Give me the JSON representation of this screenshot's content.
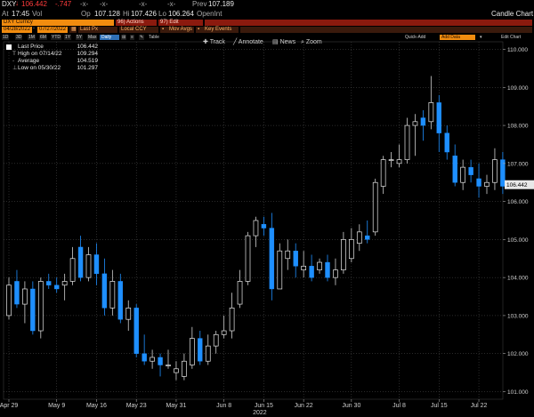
{
  "header": {
    "ticker": "DXY",
    "last_price": "106.442",
    "net_change": "-.747",
    "prev_label": "Prev",
    "prev_value": "107.189",
    "time_label": "At",
    "time": "17:45",
    "vol_label": "Vol",
    "op_label": "Op",
    "op_value": "107.128",
    "hi_label": "Hi",
    "hi_value": "107.426",
    "lo_label": "Lo",
    "lo_value": "106.264",
    "openint_label": "OpenInt",
    "chart_title": "Candle Chart"
  },
  "toolbar": {
    "security": "DXY Curncy",
    "actions": "96) Actions",
    "edit": "97) Edit",
    "start_date": "04/28/2022",
    "end_date": "07/27/2022",
    "last_px": "Last Px",
    "local_ccy": "Local CCY",
    "mov_avgs": "Mov Avgs",
    "key_events": "Key Events",
    "periods": [
      "1D",
      "3D",
      "1M",
      "6M",
      "YTD",
      "1Y",
      "5Y",
      "Max"
    ],
    "frequency": "Daily",
    "table": "Table",
    "quick_add": "Quick-Add",
    "add_data": "Add Data",
    "edit_chart": "Edit Chart"
  },
  "chart_tools": {
    "track": "Track",
    "annotate": "Annotate",
    "news": "News",
    "zoom": "Zoom"
  },
  "legend": [
    {
      "name": "Last Price",
      "value": "106.442"
    },
    {
      "name": "High on 07/14/22",
      "value": "109.294"
    },
    {
      "name": "Average",
      "value": "104.519"
    },
    {
      "name": "Low on 05/30/22",
      "value": "101.297"
    }
  ],
  "colors": {
    "up": "#ffffff",
    "down": "#1e8fff",
    "accent": "#f28c0f",
    "negative": "#ff3b3b"
  },
  "chart_data": {
    "type": "candlestick",
    "year_label": "2022",
    "ylim": [
      100.8,
      110.2
    ],
    "yticks": [
      101.0,
      102.0,
      103.0,
      104.0,
      105.0,
      106.0,
      107.0,
      108.0,
      109.0,
      110.0
    ],
    "last_price_marker": 106.442,
    "xtick_labels": [
      {
        "label": "Apr 29",
        "index": 0
      },
      {
        "label": "May 9",
        "index": 6
      },
      {
        "label": "May 16",
        "index": 11
      },
      {
        "label": "May 23",
        "index": 16
      },
      {
        "label": "May 31",
        "index": 21
      },
      {
        "label": "Jun 8",
        "index": 27
      },
      {
        "label": "Jun 15",
        "index": 32
      },
      {
        "label": "Jun 22",
        "index": 37
      },
      {
        "label": "Jun 30",
        "index": 43
      },
      {
        "label": "Jul 8",
        "index": 49
      },
      {
        "label": "Jul 15",
        "index": 54
      },
      {
        "label": "Jul 22",
        "index": 59
      }
    ],
    "candles": [
      {
        "o": 103.0,
        "h": 104.0,
        "l": 102.9,
        "c": 103.8
      },
      {
        "o": 103.9,
        "h": 104.2,
        "l": 103.2,
        "c": 103.3
      },
      {
        "o": 103.3,
        "h": 103.9,
        "l": 102.8,
        "c": 103.7
      },
      {
        "o": 103.7,
        "h": 103.9,
        "l": 102.5,
        "c": 102.6
      },
      {
        "o": 102.6,
        "h": 104.0,
        "l": 102.4,
        "c": 103.9
      },
      {
        "o": 103.9,
        "h": 104.1,
        "l": 103.7,
        "c": 103.8
      },
      {
        "o": 103.8,
        "h": 104.0,
        "l": 103.6,
        "c": 103.7
      },
      {
        "o": 103.8,
        "h": 104.1,
        "l": 103.4,
        "c": 103.9
      },
      {
        "o": 103.9,
        "h": 104.8,
        "l": 103.8,
        "c": 104.5
      },
      {
        "o": 104.8,
        "h": 105.1,
        "l": 103.9,
        "c": 104.0
      },
      {
        "o": 104.0,
        "h": 104.8,
        "l": 103.9,
        "c": 104.6
      },
      {
        "o": 104.6,
        "h": 104.9,
        "l": 103.8,
        "c": 104.1
      },
      {
        "o": 104.1,
        "h": 104.5,
        "l": 103.0,
        "c": 103.2
      },
      {
        "o": 103.2,
        "h": 104.2,
        "l": 103.0,
        "c": 103.9
      },
      {
        "o": 103.9,
        "h": 104.1,
        "l": 102.8,
        "c": 102.9
      },
      {
        "o": 102.9,
        "h": 103.4,
        "l": 102.6,
        "c": 103.2
      },
      {
        "o": 103.2,
        "h": 103.3,
        "l": 101.9,
        "c": 102.0
      },
      {
        "o": 102.0,
        "h": 102.5,
        "l": 101.7,
        "c": 101.8
      },
      {
        "o": 101.8,
        "h": 102.1,
        "l": 101.6,
        "c": 101.9
      },
      {
        "o": 101.9,
        "h": 102.0,
        "l": 101.4,
        "c": 101.7
      },
      {
        "o": 101.7,
        "h": 102.1,
        "l": 101.6,
        "c": 101.7
      },
      {
        "o": 101.5,
        "h": 101.8,
        "l": 101.3,
        "c": 101.6
      },
      {
        "o": 101.4,
        "h": 102.0,
        "l": 101.3,
        "c": 101.8
      },
      {
        "o": 101.7,
        "h": 102.7,
        "l": 101.6,
        "c": 102.4
      },
      {
        "o": 102.4,
        "h": 102.6,
        "l": 101.7,
        "c": 101.8
      },
      {
        "o": 101.8,
        "h": 102.5,
        "l": 101.7,
        "c": 102.2
      },
      {
        "o": 102.2,
        "h": 102.6,
        "l": 102.0,
        "c": 102.5
      },
      {
        "o": 102.5,
        "h": 103.0,
        "l": 102.4,
        "c": 102.6
      },
      {
        "o": 102.6,
        "h": 103.6,
        "l": 102.4,
        "c": 103.2
      },
      {
        "o": 103.3,
        "h": 104.2,
        "l": 103.2,
        "c": 103.9
      },
      {
        "o": 103.9,
        "h": 105.2,
        "l": 103.8,
        "c": 105.1
      },
      {
        "o": 105.1,
        "h": 105.6,
        "l": 104.8,
        "c": 105.5
      },
      {
        "o": 105.4,
        "h": 105.6,
        "l": 105.1,
        "c": 105.3
      },
      {
        "o": 105.3,
        "h": 105.7,
        "l": 103.4,
        "c": 103.7
      },
      {
        "o": 103.7,
        "h": 104.9,
        "l": 103.7,
        "c": 104.7
      },
      {
        "o": 104.5,
        "h": 105.0,
        "l": 104.2,
        "c": 104.7
      },
      {
        "o": 104.7,
        "h": 104.9,
        "l": 104.0,
        "c": 104.3
      },
      {
        "o": 104.2,
        "h": 104.7,
        "l": 104.0,
        "c": 104.3
      },
      {
        "o": 104.3,
        "h": 104.6,
        "l": 103.9,
        "c": 104.0
      },
      {
        "o": 104.2,
        "h": 104.5,
        "l": 104.1,
        "c": 104.4
      },
      {
        "o": 104.4,
        "h": 104.6,
        "l": 103.9,
        "c": 104.0
      },
      {
        "o": 104.0,
        "h": 104.5,
        "l": 103.8,
        "c": 104.2
      },
      {
        "o": 104.2,
        "h": 105.2,
        "l": 104.1,
        "c": 105.0
      },
      {
        "o": 104.5,
        "h": 105.3,
        "l": 104.4,
        "c": 105.0
      },
      {
        "o": 104.9,
        "h": 105.4,
        "l": 104.7,
        "c": 105.2
      },
      {
        "o": 105.1,
        "h": 105.5,
        "l": 104.9,
        "c": 105.0
      },
      {
        "o": 105.2,
        "h": 106.6,
        "l": 105.1,
        "c": 106.5
      },
      {
        "o": 106.4,
        "h": 107.2,
        "l": 106.2,
        "c": 107.1
      },
      {
        "o": 107.1,
        "h": 107.3,
        "l": 106.9,
        "c": 107.1
      },
      {
        "o": 107.0,
        "h": 107.5,
        "l": 106.9,
        "c": 107.1
      },
      {
        "o": 107.1,
        "h": 108.2,
        "l": 107.0,
        "c": 108.0
      },
      {
        "o": 108.0,
        "h": 108.3,
        "l": 107.2,
        "c": 108.1
      },
      {
        "o": 108.2,
        "h": 108.4,
        "l": 107.6,
        "c": 108.0
      },
      {
        "o": 108.1,
        "h": 109.3,
        "l": 107.9,
        "c": 108.6
      },
      {
        "o": 108.6,
        "h": 108.8,
        "l": 107.3,
        "c": 107.8
      },
      {
        "o": 107.8,
        "h": 108.0,
        "l": 107.1,
        "c": 107.3
      },
      {
        "o": 107.2,
        "h": 107.5,
        "l": 106.4,
        "c": 106.5
      },
      {
        "o": 106.5,
        "h": 107.1,
        "l": 106.3,
        "c": 106.9
      },
      {
        "o": 106.9,
        "h": 107.1,
        "l": 106.5,
        "c": 106.7
      },
      {
        "o": 106.6,
        "h": 107.0,
        "l": 106.1,
        "c": 106.4
      },
      {
        "o": 106.4,
        "h": 106.7,
        "l": 106.2,
        "c": 106.5
      },
      {
        "o": 106.5,
        "h": 107.4,
        "l": 106.3,
        "c": 107.1
      },
      {
        "o": 107.1,
        "h": 107.3,
        "l": 106.2,
        "c": 106.4
      }
    ]
  }
}
